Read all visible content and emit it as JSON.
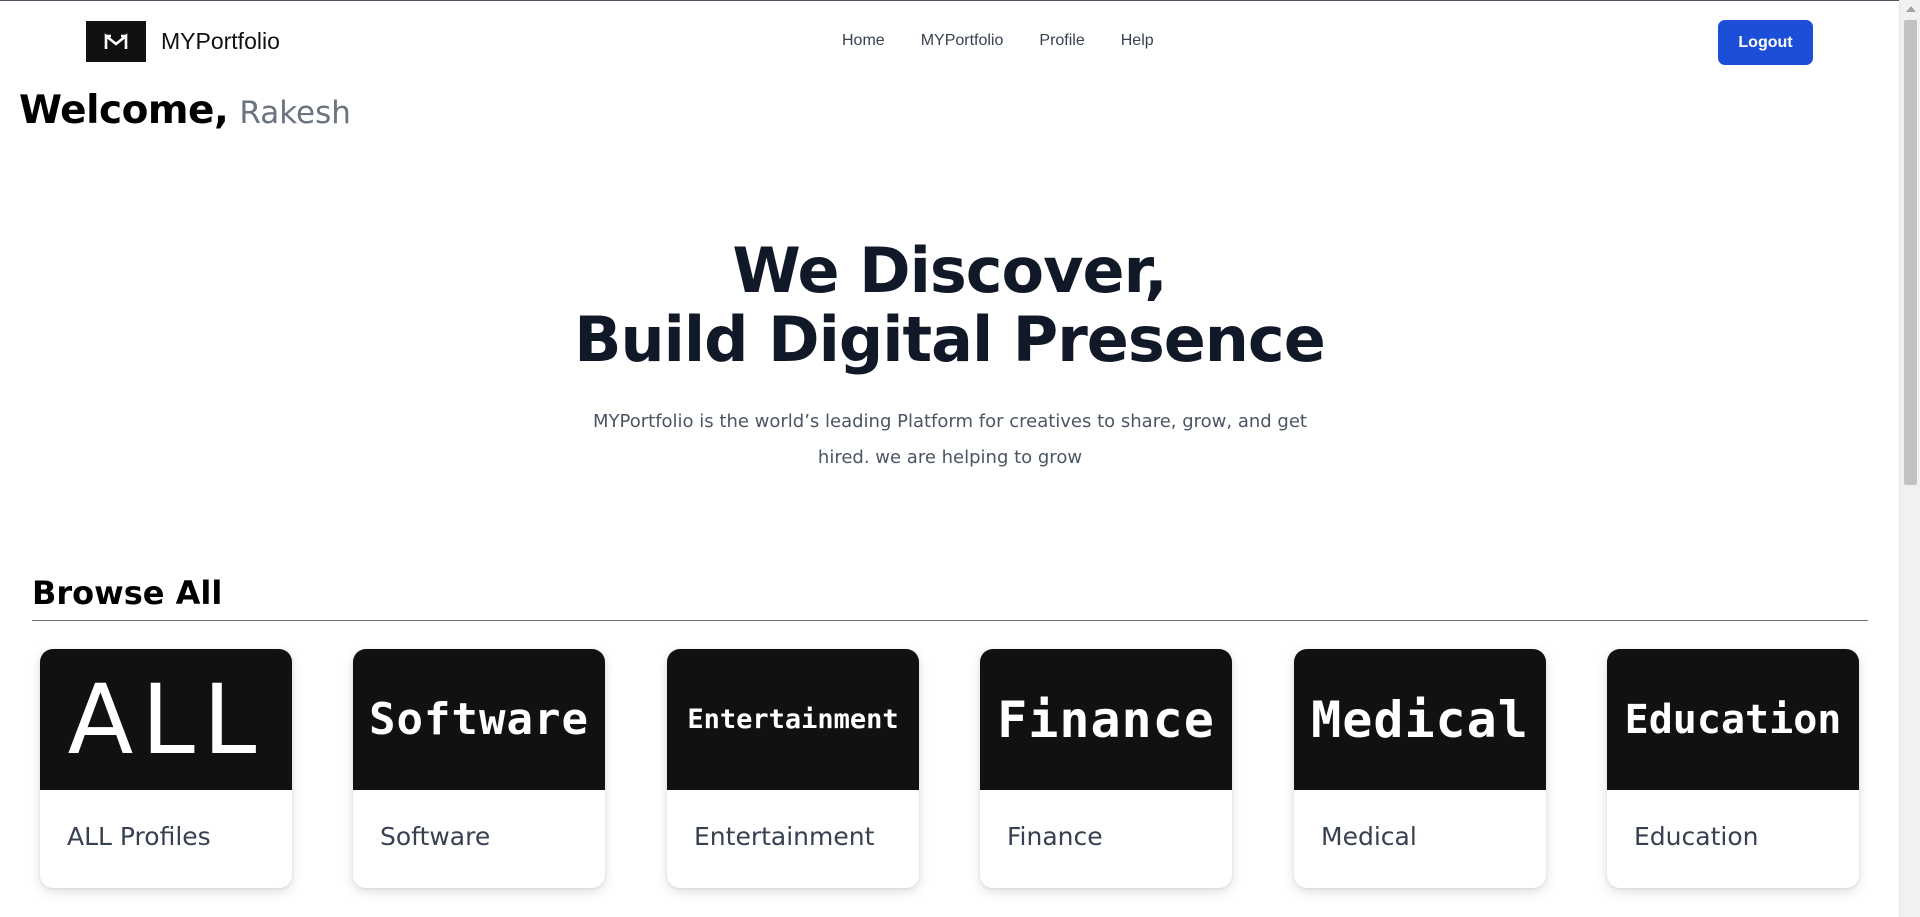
{
  "header": {
    "brand_name": "MYPortfolio",
    "nav": [
      "Home",
      "MYPortfolio",
      "Profile",
      "Help"
    ],
    "logout_label": "Logout"
  },
  "welcome": {
    "label": "Welcome,",
    "name": "Rakesh"
  },
  "hero": {
    "title_line1": "We Discover,",
    "title_line2": "Build Digital Presence",
    "subtitle": "MYPortfolio is the world’s leading Platform for creatives to share, grow, and get hired. we are helping to grow"
  },
  "browse": {
    "title": "Browse All",
    "categories": [
      {
        "image_text": "ALL",
        "label": "ALL Profiles"
      },
      {
        "image_text": "Software",
        "label": "Software"
      },
      {
        "image_text": "Entertainment",
        "label": "Entertainment"
      },
      {
        "image_text": "Finance",
        "label": "Finance"
      },
      {
        "image_text": "Medical",
        "label": "Medical"
      },
      {
        "image_text": "Education",
        "label": "Education"
      }
    ]
  },
  "colors": {
    "primary": "#1d4ed8",
    "card_image_bg": "#111111",
    "heading": "#111827",
    "muted": "#6b7280"
  },
  "icons": {
    "logo": "m-logo-icon",
    "scroll_up": "arrow-up-icon"
  }
}
